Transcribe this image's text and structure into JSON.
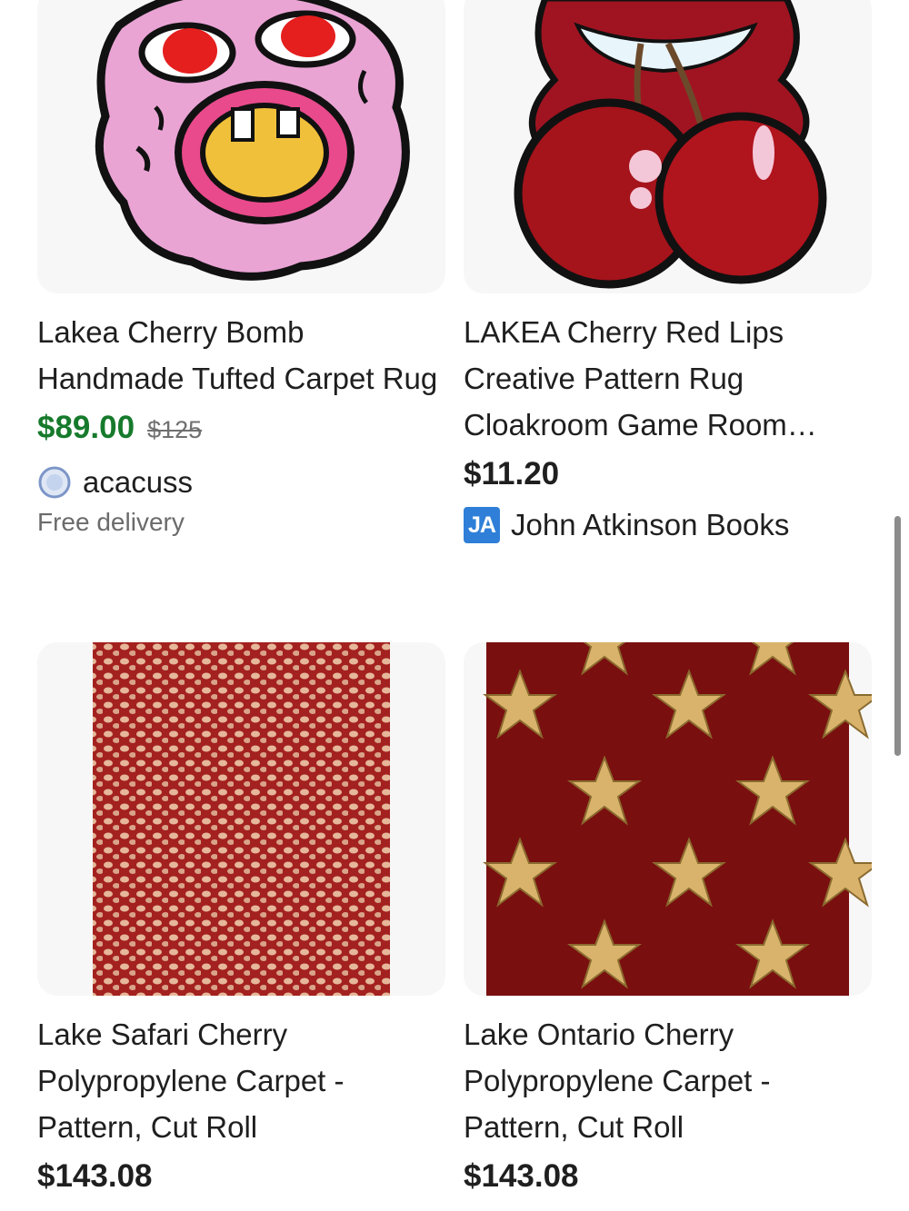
{
  "listings": [
    {
      "title": "Lakea Cherry Bomb Handmade Tufted Carpet Rug",
      "price": "$89.00",
      "original_price": "$125",
      "seller": "acacuss",
      "seller_icon": "globe-icon",
      "shipping": "Free delivery"
    },
    {
      "title": "LAKEA Cherry Red Lips Creative Pattern Rug Cloakroom Game Room…",
      "price": "$11.20",
      "seller": "John Atkinson Books",
      "seller_badge": "JA"
    },
    {
      "title": "Lake Safari Cherry Polypropylene Carpet - Pattern, Cut Roll",
      "price": "$143.08"
    },
    {
      "title": "Lake Ontario Cherry Polypropylene Carpet - Pattern, Cut Roll",
      "price": "$143.08"
    }
  ],
  "colors": {
    "sale_price": "#167a2c",
    "badge_blue": "#2f7fd8"
  }
}
